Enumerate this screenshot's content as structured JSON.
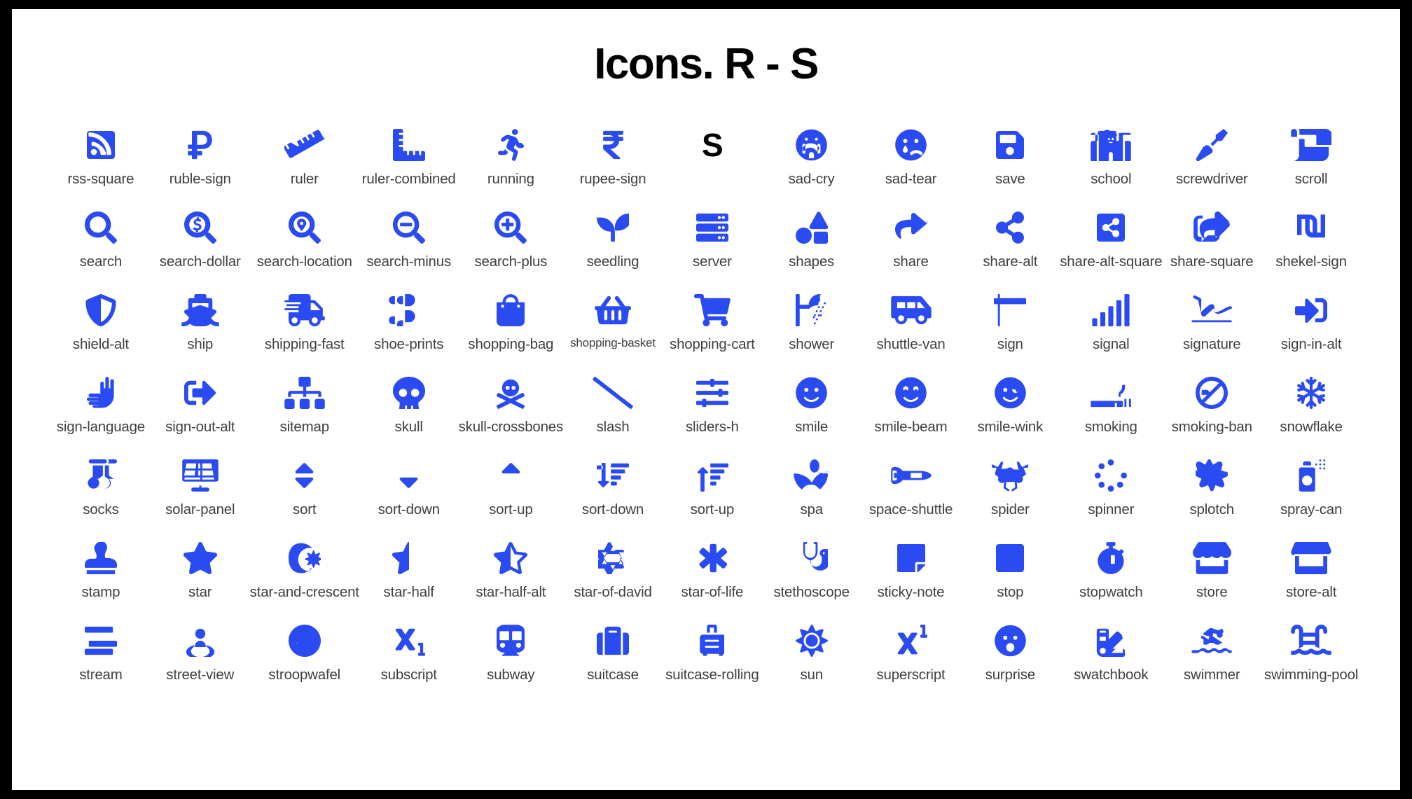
{
  "page": {
    "title": "Icons. R - S",
    "accent_color": "#2B4BF2",
    "caption_color": "#414042",
    "background_color": "#FFFFFF",
    "frame_color": "#000000",
    "columns": 13,
    "rows": 7,
    "icon_count": 90
  },
  "divider": {
    "label": "S",
    "name": "letter-s-divider"
  },
  "rows": [
    {
      "cells": [
        {
          "name": "rss-square",
          "label": "rss-square"
        },
        {
          "name": "ruble-sign",
          "label": "ruble-sign"
        },
        {
          "name": "ruler",
          "label": "ruler"
        },
        {
          "name": "ruler-combined",
          "label": "ruler-combined"
        },
        {
          "name": "running",
          "label": "running"
        },
        {
          "name": "rupee-sign",
          "label": "rupee-sign"
        },
        {
          "name": "letter-s-divider",
          "label": "S",
          "divider": true
        },
        {
          "name": "sad-cry",
          "label": "sad-cry"
        },
        {
          "name": "sad-tear",
          "label": "sad-tear"
        },
        {
          "name": "save",
          "label": "save"
        },
        {
          "name": "school",
          "label": "school"
        },
        {
          "name": "screwdriver",
          "label": "screwdriver"
        },
        {
          "name": "scroll",
          "label": "scroll"
        }
      ]
    },
    {
      "cells": [
        {
          "name": "search",
          "label": "search"
        },
        {
          "name": "search-dollar",
          "label": "search-dollar"
        },
        {
          "name": "search-location",
          "label": "search-location"
        },
        {
          "name": "search-minus",
          "label": "search-minus"
        },
        {
          "name": "search-plus",
          "label": "search-plus"
        },
        {
          "name": "seedling",
          "label": "seedling"
        },
        {
          "name": "server",
          "label": "server"
        },
        {
          "name": "shapes",
          "label": "shapes"
        },
        {
          "name": "share",
          "label": "share"
        },
        {
          "name": "share-alt",
          "label": "share-alt"
        },
        {
          "name": "share-alt-square",
          "label": "share-alt-square"
        },
        {
          "name": "share-square",
          "label": "share-square"
        },
        {
          "name": "shekel-sign",
          "label": "shekel-sign"
        }
      ]
    },
    {
      "cells": [
        {
          "name": "shield-alt",
          "label": "shield-alt"
        },
        {
          "name": "ship",
          "label": "ship"
        },
        {
          "name": "shipping-fast",
          "label": "shipping-fast"
        },
        {
          "name": "shoe-prints",
          "label": "shoe-prints"
        },
        {
          "name": "shopping-bag",
          "label": "shopping-bag"
        },
        {
          "name": "shopping-basket",
          "label": "shopping-basket",
          "small": true
        },
        {
          "name": "shopping-cart",
          "label": "shopping-cart"
        },
        {
          "name": "shower",
          "label": "shower"
        },
        {
          "name": "shuttle-van",
          "label": "shuttle-van"
        },
        {
          "name": "sign",
          "label": "sign"
        },
        {
          "name": "signal",
          "label": "signal"
        },
        {
          "name": "signature",
          "label": "signature"
        },
        {
          "name": "sign-in-alt",
          "label": "sign-in-alt"
        }
      ]
    },
    {
      "cells": [
        {
          "name": "sign-language",
          "label": "sign-language"
        },
        {
          "name": "sign-out-alt",
          "label": "sign-out-alt"
        },
        {
          "name": "sitemap",
          "label": "sitemap"
        },
        {
          "name": "skull",
          "label": "skull"
        },
        {
          "name": "skull-crossbones",
          "label": "skull-crossbones"
        },
        {
          "name": "slash",
          "label": "slash"
        },
        {
          "name": "sliders-h",
          "label": "sliders-h"
        },
        {
          "name": "smile",
          "label": "smile"
        },
        {
          "name": "smile-beam",
          "label": "smile-beam"
        },
        {
          "name": "smile-wink",
          "label": "smile-wink"
        },
        {
          "name": "smoking",
          "label": "smoking"
        },
        {
          "name": "smoking-ban",
          "label": "smoking-ban"
        },
        {
          "name": "snowflake",
          "label": "snowflake"
        }
      ]
    },
    {
      "cells": [
        {
          "name": "socks",
          "label": "socks"
        },
        {
          "name": "solar-panel",
          "label": "solar-panel"
        },
        {
          "name": "sort",
          "label": "sort"
        },
        {
          "name": "sort-down",
          "label": "sort-down"
        },
        {
          "name": "sort-up",
          "label": "sort-up"
        },
        {
          "name": "sort-amount-down",
          "label": "sort-down"
        },
        {
          "name": "sort-amount-up",
          "label": "sort-up"
        },
        {
          "name": "spa",
          "label": "spa"
        },
        {
          "name": "space-shuttle",
          "label": "space-shuttle"
        },
        {
          "name": "spider",
          "label": "spider"
        },
        {
          "name": "spinner",
          "label": "spinner"
        },
        {
          "name": "splotch",
          "label": "splotch"
        },
        {
          "name": "spray-can",
          "label": "spray-can"
        }
      ]
    },
    {
      "cells": [
        {
          "name": "stamp",
          "label": "stamp"
        },
        {
          "name": "star",
          "label": "star"
        },
        {
          "name": "star-and-crescent",
          "label": "star-and-crescent"
        },
        {
          "name": "star-half",
          "label": "star-half"
        },
        {
          "name": "star-half-alt",
          "label": "star-half-alt"
        },
        {
          "name": "star-of-david",
          "label": "star-of-david"
        },
        {
          "name": "star-of-life",
          "label": "star-of-life"
        },
        {
          "name": "stethoscope",
          "label": "stethoscope"
        },
        {
          "name": "sticky-note",
          "label": "sticky-note"
        },
        {
          "name": "stop",
          "label": "stop"
        },
        {
          "name": "stopwatch",
          "label": "stopwatch"
        },
        {
          "name": "store",
          "label": "store"
        },
        {
          "name": "store-alt",
          "label": "store-alt"
        }
      ]
    },
    {
      "cells": [
        {
          "name": "stream",
          "label": "stream"
        },
        {
          "name": "street-view",
          "label": "street-view"
        },
        {
          "name": "stroopwafel",
          "label": "stroopwafel"
        },
        {
          "name": "subscript",
          "label": "subscript"
        },
        {
          "name": "subway",
          "label": "subway"
        },
        {
          "name": "suitcase",
          "label": "suitcase"
        },
        {
          "name": "suitcase-rolling",
          "label": "suitcase-rolling"
        },
        {
          "name": "sun",
          "label": "sun"
        },
        {
          "name": "superscript",
          "label": "superscript"
        },
        {
          "name": "surprise",
          "label": "surprise"
        },
        {
          "name": "swatchbook",
          "label": "swatchbook"
        },
        {
          "name": "swimmer",
          "label": "swimmer"
        },
        {
          "name": "swimming-pool",
          "label": "swimming-pool"
        }
      ]
    }
  ]
}
